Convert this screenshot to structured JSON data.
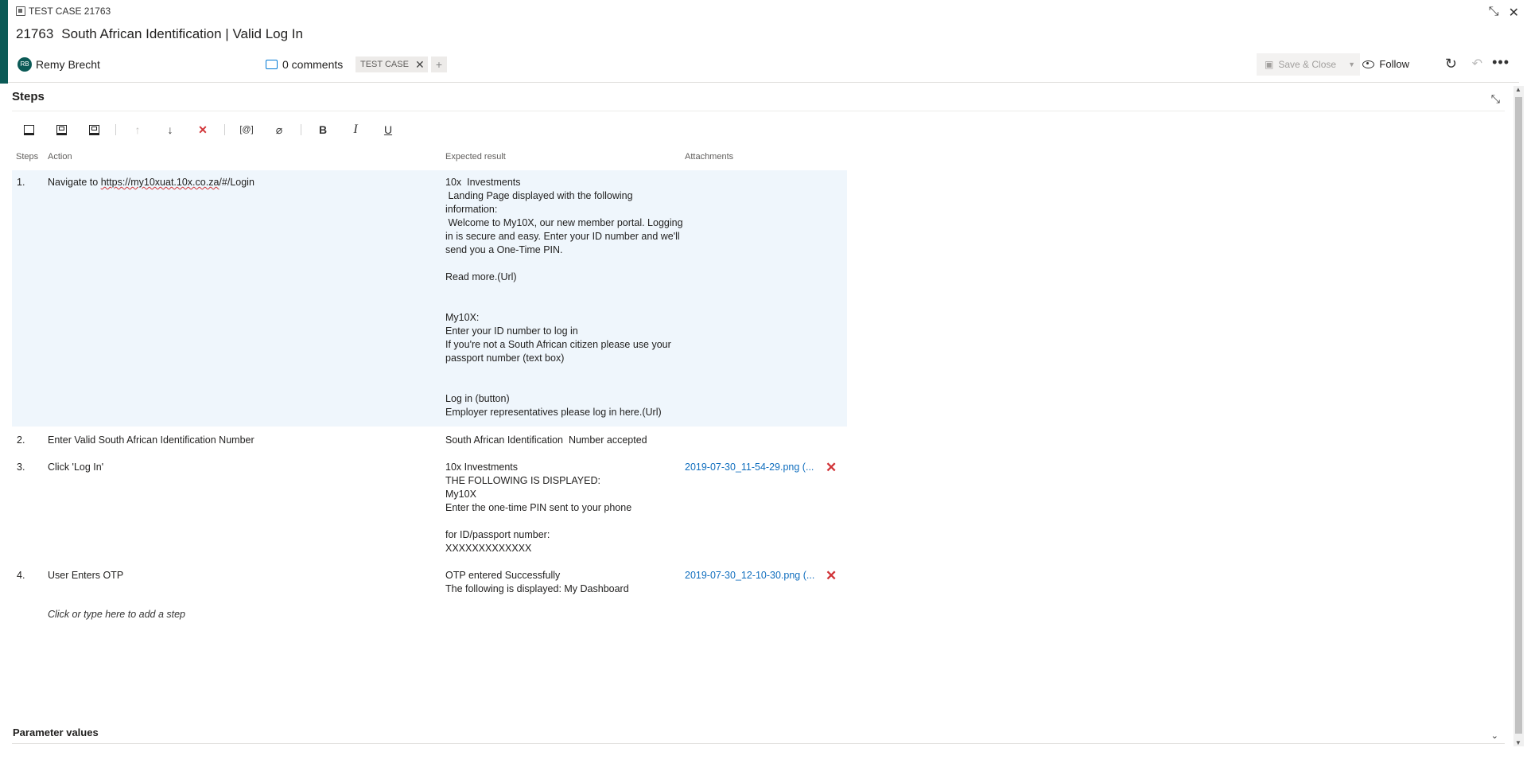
{
  "header": {
    "type_label": "TEST CASE 21763",
    "id": "21763",
    "title": "South African Identification | Valid Log In",
    "assignee_initials": "RB",
    "assignee": "Remy Brecht",
    "comments": "0 comments",
    "tag": "TEST CASE",
    "save_label": "Save & Close",
    "follow_label": "Follow"
  },
  "steps_section": {
    "title": "Steps",
    "columns": {
      "steps": "Steps",
      "action": "Action",
      "expected": "Expected result",
      "attachments": "Attachments"
    },
    "rows": [
      {
        "num": "1.",
        "action_prefix": "Navigate to ",
        "action_url": "https://my10xuat.10x.co.za",
        "action_suffix": "/#/Login",
        "expected": "10x  Investments\n Landing Page displayed with the following information:\n Welcome to My10X, our new member portal. Logging in is secure and easy. Enter your ID number and we'll send you a One-Time PIN.\n\nRead more.(Url)\n\n\nMy10X:\nEnter your ID number to log in\nIf you're not a South African citizen please use your passport number (text box)\n\n\nLog in (button)\nEmployer representatives please log in here.(Url)",
        "attachment": ""
      },
      {
        "num": "2.",
        "action": "Enter Valid South African Identification Number",
        "expected": "South African Identification  Number accepted",
        "attachment": ""
      },
      {
        "num": "3.",
        "action": "Click 'Log In'",
        "expected": "10x Investments\nTHE FOLLOWING IS DISPLAYED:\nMy10X\nEnter the one-time PIN sent to your phone\n\nfor ID/passport number:\nXXXXXXXXXXXXX",
        "attachment": "2019-07-30_11-54-29.png (..."
      },
      {
        "num": "4.",
        "action": "User Enters OTP",
        "expected": "OTP entered Successfully\nThe following is displayed: My Dashboard",
        "attachment": "2019-07-30_12-10-30.png (..."
      }
    ],
    "add_step": "Click or type here to add a step"
  },
  "toolbar": {
    "bold": "B",
    "italic": "I",
    "underline": "U"
  },
  "parameters": {
    "title": "Parameter values"
  }
}
